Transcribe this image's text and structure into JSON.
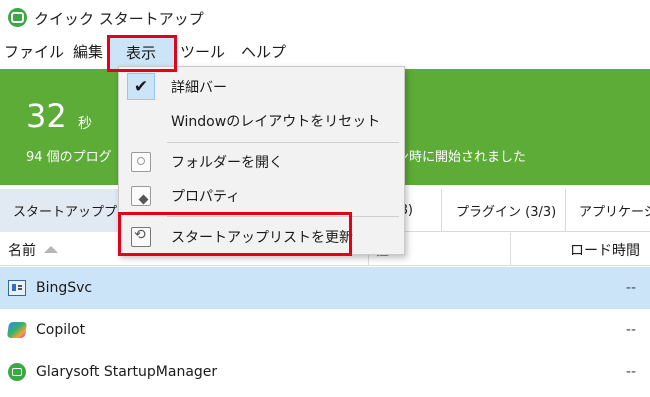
{
  "window": {
    "title": "クイック スタートアップ",
    "icon": "glary-app-icon"
  },
  "menubar": {
    "file": "ファイル",
    "edit": "編集",
    "view": "表示",
    "tools": "ツール",
    "help": "ヘルプ"
  },
  "banner": {
    "seconds_value": "32",
    "seconds_unit": "秒",
    "line_left": "94 個のプログ",
    "line_right": "ン時に開始されました",
    "color": "#5dac37"
  },
  "tabs": {
    "startup": "スタートアッププロ",
    "mid": "3/8)",
    "plugins": "プラグイン (3/3)",
    "apps": "アプリケーシ"
  },
  "columns": {
    "name": "名前",
    "attr": "性",
    "load_time": "ロード時間"
  },
  "rows": [
    {
      "name": "BingSvc",
      "load": "--",
      "selected": true,
      "icon": "bing-icon"
    },
    {
      "name": "Copilot",
      "load": "--",
      "selected": false,
      "icon": "copilot-icon"
    },
    {
      "name": "Glarysoft StartupManager",
      "load": "--",
      "selected": false,
      "icon": "glary-icon"
    }
  ],
  "view_menu": {
    "items": [
      {
        "label": "詳細バー",
        "checked": true,
        "icon": "check-icon"
      },
      {
        "label": "Windowのレイアウトをリセット",
        "checked": false,
        "icon": ""
      },
      {
        "label": "フォルダーを開く",
        "checked": false,
        "icon": "folder-search-icon"
      },
      {
        "label": "プロパティ",
        "checked": false,
        "icon": "properties-icon"
      },
      {
        "label": "スタートアップリストを更新",
        "checked": false,
        "icon": "refresh-icon"
      }
    ]
  },
  "check_glyph": "✔",
  "highlight_color": "#e3001b",
  "selection_color": "#cce4f7"
}
